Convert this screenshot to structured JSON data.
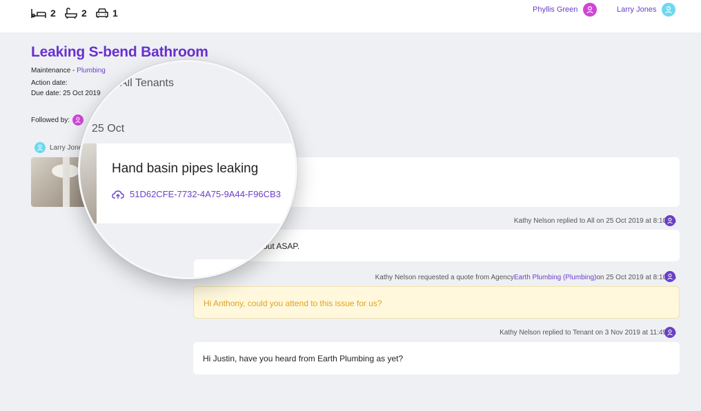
{
  "topbar": {
    "features": [
      {
        "icon": "bed-icon",
        "count": "2"
      },
      {
        "icon": "bath-icon",
        "count": "2"
      },
      {
        "icon": "car-icon",
        "count": "1"
      }
    ],
    "users": [
      {
        "name": "Phyllis Green",
        "color": "#cf46d7"
      },
      {
        "name": "Larry Jones",
        "color": "#6fd8ee"
      }
    ]
  },
  "job": {
    "title": "Leaking S-bend Bathroom",
    "category": "Maintenance - ",
    "subcategory": "Plumbing",
    "action_date_label": "Action date:",
    "due_date_label": "Due date: 25 Oct 2019",
    "followed_by_label": "Followed by:"
  },
  "post": {
    "author": "Larry Jones",
    "audience": "All Tenants",
    "date": "25 Oct",
    "title": "Hand basin pipes leaking",
    "attachment": "51D62CFE-7732-4A75-9A44-F96CB3"
  },
  "messages": [
    {
      "meta": "Kathy Nelson replied to All on 25 Oct 2019 at 8:10am",
      "text": "I'll get someone out ASAP."
    },
    {
      "meta_prefix": "Kathy Nelson requested a quote from Agency ",
      "meta_link": "Earth Plumbing (Plumbing)",
      "meta_suffix": "on 25 Oct 2019 at 8:10am",
      "text": "Hi Anthony, could you attend to this issue for us?"
    },
    {
      "meta": "Kathy Nelson replied to Tenant on 3 Nov 2019 at 11:49am",
      "text": "Hi Justin, have you heard from Earth Plumbing as yet?"
    }
  ],
  "colors": {
    "brand": "#6a2fd0",
    "link": "#6a3fc8",
    "quote_text": "#e0a322",
    "quote_bg": "#fff8dc",
    "page_bg": "#eef0f3"
  }
}
